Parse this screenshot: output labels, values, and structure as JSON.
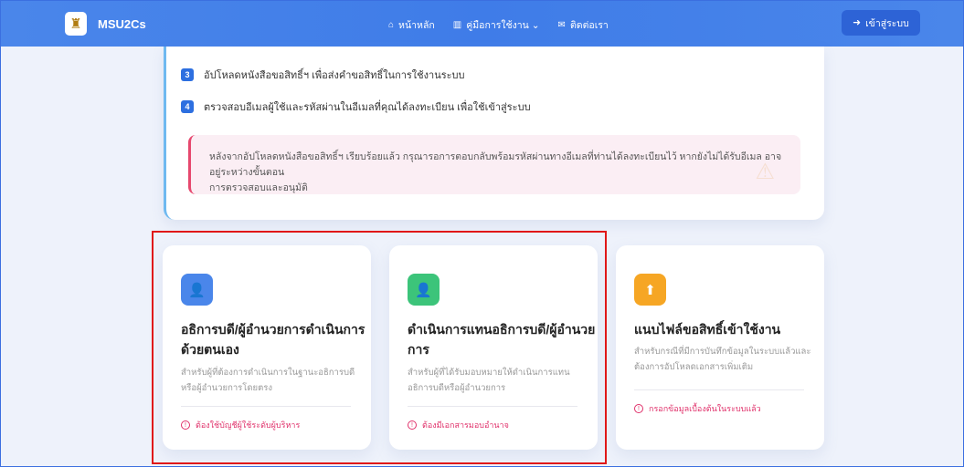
{
  "navbar": {
    "brand": "MSU2Cs",
    "links": [
      {
        "icon": "home-icon",
        "glyph": "⌂",
        "label": "หน้าหลัก"
      },
      {
        "icon": "book-icon",
        "glyph": "▥",
        "label": "คู่มือการใช้งาน ⌄"
      },
      {
        "icon": "mail-icon",
        "glyph": "✉",
        "label": "ติดต่อเรา"
      }
    ],
    "login_label": "เข้าสู่ระบบ",
    "accent": "#4a86ea"
  },
  "steps": [
    {
      "num": "3",
      "text": "อัปโหลดหนังสือขอสิทธิ์ฯ เพื่อส่งคำขอสิทธิ์ในการใช้งานระบบ"
    },
    {
      "num": "4",
      "text": "ตรวจสอบอีเมลผู้ใช้และรหัสผ่านในอีเมลที่คุณได้ลงทะเบียน เพื่อใช้เข้าสู่ระบบ"
    }
  ],
  "notice": {
    "line1": "หลังจากอัปโหลดหนังสือขอสิทธิ์ฯ เรียบร้อยแล้ว กรุณารอการตอบกลับพร้อมรหัสผ่านทางอีเมลที่ท่านได้ลงทะเบียนไว้ หากยังไม่ได้รับอีเมล อาจอยู่ระหว่างขั้นตอน",
    "line2": "การตรวจสอบและอนุมัติ"
  },
  "cards": [
    {
      "icon": "user-shield-icon",
      "glyph": "👤",
      "color": "#4a86ea",
      "title_1": "อธิการบดี/ผู้อำนวยการดำเนินการ",
      "title_2": "ด้วยตนเอง",
      "desc_1": "สำหรับผู้ที่ต้องการดำเนินการในฐานะอธิการบดี",
      "desc_2": "หรือผู้อำนวยการโดยตรง",
      "note": "ต้องใช้บัญชีผู้ใช้ระดับผู้บริหาร"
    },
    {
      "icon": "user-tie-icon",
      "glyph": "👤",
      "color": "#3cc47a",
      "title_1": "ดำเนินการแทนอธิการบดี/ผู้อำนวย",
      "title_2": "การ",
      "desc_1": "สำหรับผู้ที่ได้รับมอบหมายให้ดำเนินการแทน",
      "desc_2": "อธิการบดีหรือผู้อำนวยการ",
      "note": "ต้องมีเอกสารมอบอำนาจ"
    },
    {
      "icon": "file-upload-icon",
      "glyph": "⬆",
      "color": "#f6a624",
      "title_1": "แนบไฟล์ขอสิทธิ์เข้าใช้งาน",
      "title_2": "",
      "desc_1": "สำหรับกรณีที่มีการบันทึกข้อมูลในระบบแล้วและ",
      "desc_2": "ต้องการอัปโหลดเอกสารเพิ่มเติม",
      "note": "กรอกข้อมูลเบื้องต้นในระบบแล้ว"
    }
  ]
}
